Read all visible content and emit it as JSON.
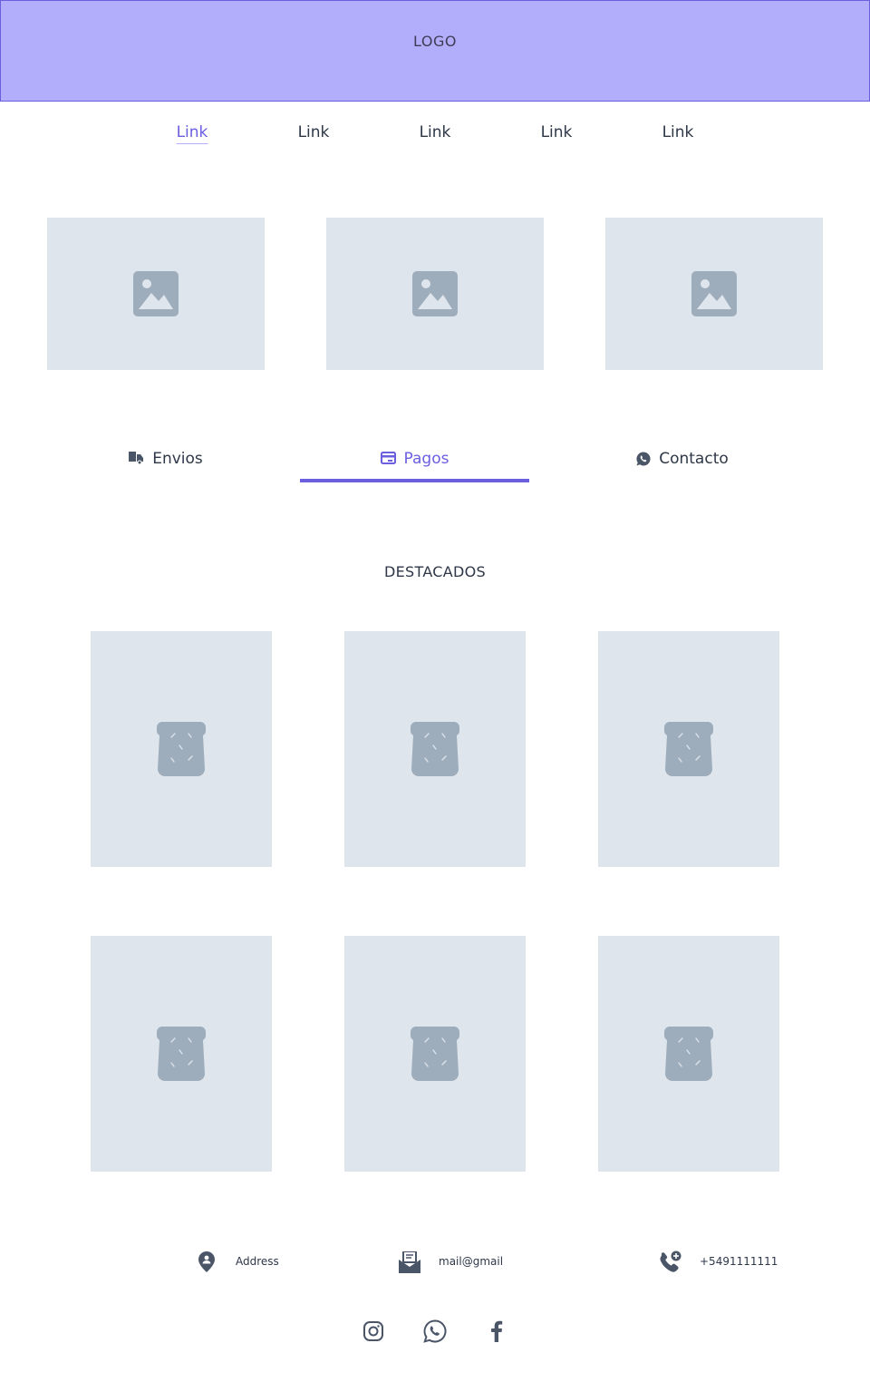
{
  "header": {
    "logo": "LOGO"
  },
  "nav": {
    "links": [
      {
        "label": "Link",
        "active": true
      },
      {
        "label": "Link",
        "active": false
      },
      {
        "label": "Link",
        "active": false
      },
      {
        "label": "Link",
        "active": false
      },
      {
        "label": "Link",
        "active": false
      }
    ]
  },
  "gallery": {
    "count": 3,
    "icon": "image-placeholder-icon"
  },
  "tabs": [
    {
      "label": "Envios",
      "icon": "truck-icon",
      "active": false
    },
    {
      "label": "Pagos",
      "icon": "credit-card-icon",
      "active": true
    },
    {
      "label": "Contacto",
      "icon": "whatsapp-icon",
      "active": false
    }
  ],
  "featured": {
    "title": "DESTACADOS",
    "count": 6,
    "icon": "bread-icon"
  },
  "contact": {
    "address": "Address",
    "email": "mail@gmail",
    "phone": "+5491111111"
  },
  "social": [
    "instagram-icon",
    "whatsapp-icon",
    "facebook-icon"
  ],
  "colors": {
    "accent": "#6b5fe0",
    "header_bg": "#b3aefb",
    "placeholder_bg": "#dfe5ed",
    "placeholder_icon": "#9eadbb",
    "text": "#2d3748"
  }
}
